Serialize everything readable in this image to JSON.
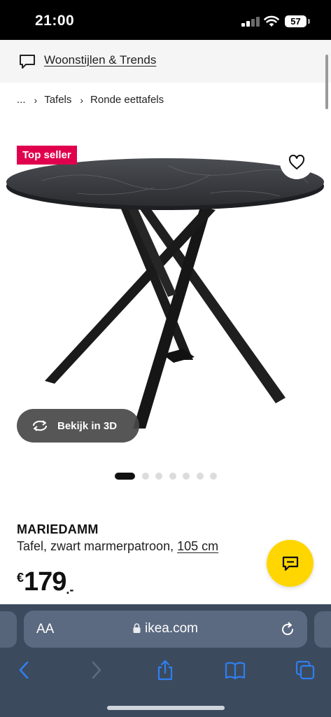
{
  "status_bar": {
    "time": "21:00",
    "battery": "57"
  },
  "banner": {
    "link": "Woonstijlen & Trends",
    "icon": "chat-bubble-icon"
  },
  "breadcrumb": {
    "ellipsis": "...",
    "items": [
      "Tafels",
      "Ronde eettafels"
    ]
  },
  "product": {
    "badge": "Top seller",
    "view3d_label": "Bekijk in 3D",
    "carousel": {
      "count": 7,
      "active_index": 0
    },
    "name": "MARIEDAMM",
    "description": "Tafel, zwart marmerpatroon,",
    "size_link": "105 cm",
    "price": {
      "currency": "€",
      "amount": "179",
      "decimals": ".-"
    }
  },
  "browser": {
    "aa": "AA",
    "url": "ikea.com"
  },
  "colors": {
    "badge": "#e0004d",
    "chat_fab": "#ffd600",
    "safari_bar": "#3c4a5e",
    "toolbar_icon": "#2f7ff0"
  }
}
